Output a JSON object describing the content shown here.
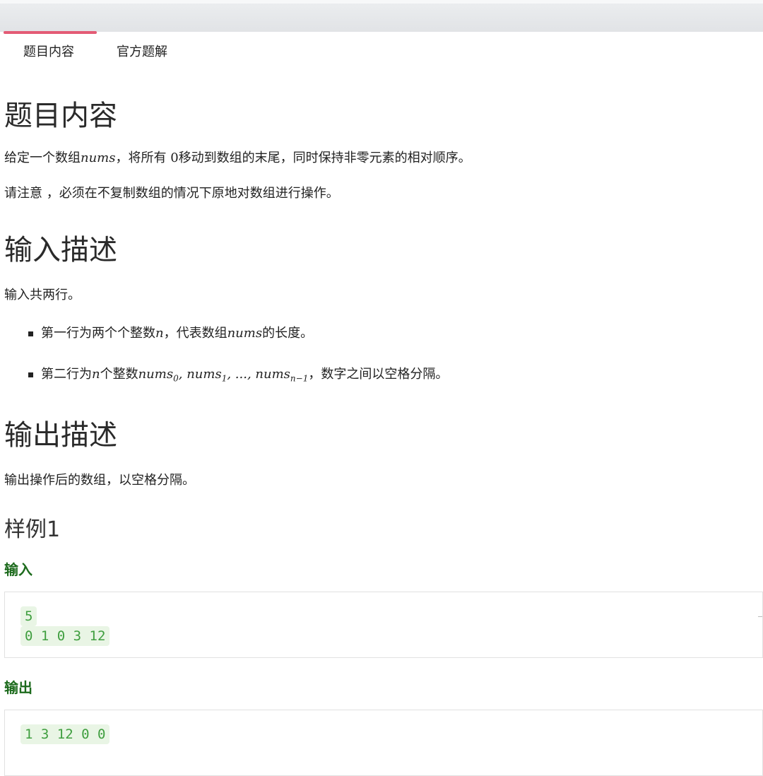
{
  "tabs": [
    {
      "label": "题目内容"
    },
    {
      "label": "官方题解"
    }
  ],
  "problem": {
    "heading": "题目内容",
    "p1_before": "给定一个数组",
    "p1_var": "nums",
    "p1_mid": "，将所有 ",
    "p1_zero": "0",
    "p1_after": "移动到数组的末尾，同时保持非零元素的相对顺序。",
    "p2": "请注意 ，必须在不复制数组的情况下原地对数组进行操作。"
  },
  "input_desc": {
    "heading": "输入描述",
    "intro": "输入共两行。",
    "item1_a": "第一行为两个个整数",
    "item1_n": "n",
    "item1_b": "，代表数组",
    "item1_var": "nums",
    "item1_c": "的长度。",
    "item2_a": "第二行为",
    "item2_n": "n",
    "item2_b": "个整数",
    "item2_math": "nums",
    "item2_sub0": "0",
    "item2_sub1": "1",
    "item2_dots": "...",
    "item2_subn": "n−1",
    "item2_c": "，数字之间以空格分隔。"
  },
  "output_desc": {
    "heading": "输出描述",
    "text": "输出操作后的数组，以空格分隔。"
  },
  "sample": {
    "title": "样例1",
    "input_label": "输入",
    "input_line1": "5",
    "input_line2": "0 1 0 3 12",
    "output_label": "输出",
    "output_line1": "1 3 12 0 0"
  }
}
